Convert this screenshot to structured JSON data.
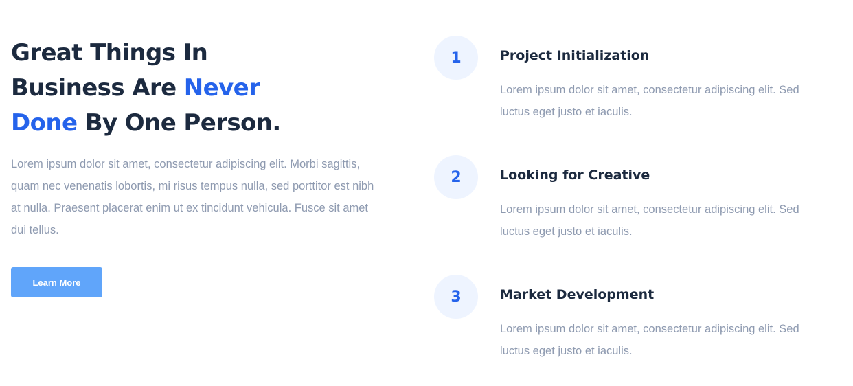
{
  "hero": {
    "headline_part1": "Great Things In Business Are ",
    "headline_accent": "Never Done",
    "headline_part2": " By One Person.",
    "body": "Lorem ipsum dolor sit amet, consectetur adipiscing elit. Morbi sagittis, quam nec venenatis lobortis, mi risus tempus nulla, sed porttitor est nibh at nulla. Praesent placerat enim ut ex tincidunt vehicula. Fusce sit amet dui tellus.",
    "button_label": "Learn More"
  },
  "steps": [
    {
      "number": "1",
      "title": "Project Initialization",
      "text": "Lorem ipsum dolor sit amet, consectetur adipiscing elit. Sed luctus eget justo et iaculis."
    },
    {
      "number": "2",
      "title": "Looking for Creative",
      "text": "Lorem ipsum dolor sit amet, consectetur adipiscing elit. Sed luctus eget justo et iaculis."
    },
    {
      "number": "3",
      "title": "Market Development",
      "text": "Lorem ipsum dolor sit amet, consectetur adipiscing elit. Sed luctus eget justo et iaculis."
    }
  ],
  "colors": {
    "heading": "#1c2a3f",
    "accent": "#2563eb",
    "body_text": "#8e9ab0",
    "button_bg": "#60a5fa",
    "number_circle_bg": "#eef4ff"
  }
}
